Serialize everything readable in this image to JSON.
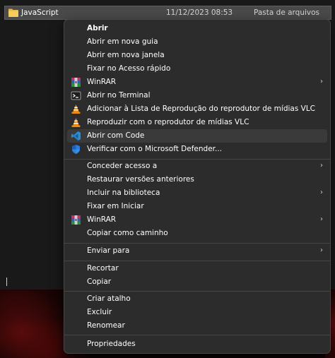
{
  "explorer": {
    "row": {
      "name": "JavaScript",
      "date": "11/12/2023 08:53",
      "type": "Pasta de arquivos"
    }
  },
  "menu": {
    "items": [
      {
        "label": "Abrir",
        "icon": "none"
      },
      {
        "label": "Abrir em nova guia",
        "icon": "none"
      },
      {
        "label": "Abrir em nova janela",
        "icon": "none"
      },
      {
        "label": "Fixar no Acesso rápido",
        "icon": "none"
      },
      {
        "label": "WinRAR",
        "icon": "winrar-icon",
        "submenu": true
      },
      {
        "label": "Abrir no Terminal",
        "icon": "terminal-icon"
      },
      {
        "label": "Adicionar à Lista de Reprodução do reprodutor de mídias VLC",
        "icon": "vlc-icon"
      },
      {
        "label": "Reproduzir com o reprodutor de mídias VLC",
        "icon": "vlc-icon"
      },
      {
        "label": "Abrir com Code",
        "icon": "vscode-icon",
        "highlighted": true
      },
      {
        "label": "Verificar com o Microsoft Defender...",
        "icon": "defender-icon"
      },
      {
        "label": "Conceder acesso a",
        "icon": "none",
        "submenu": true
      },
      {
        "label": "Restaurar versões anteriores",
        "icon": "none"
      },
      {
        "label": "Incluir na biblioteca",
        "icon": "none",
        "submenu": true
      },
      {
        "label": "Fixar em Iniciar",
        "icon": "none"
      },
      {
        "label": "WinRAR",
        "icon": "winrar-icon",
        "submenu": true
      },
      {
        "label": "Copiar como caminho",
        "icon": "none"
      },
      {
        "label": "Enviar para",
        "icon": "none",
        "submenu": true
      },
      {
        "label": "Recortar",
        "icon": "none"
      },
      {
        "label": "Copiar",
        "icon": "none"
      },
      {
        "label": "Criar atalho",
        "icon": "none"
      },
      {
        "label": "Excluir",
        "icon": "none"
      },
      {
        "label": "Renomear",
        "icon": "none"
      },
      {
        "label": "Propriedades",
        "icon": "none"
      }
    ],
    "submenu_glyph": "›"
  },
  "colors": {
    "menu_bg": "#2c2c2c",
    "hover_bg": "#3a3a3a",
    "separator": "#454545",
    "selected_row": "#4a4a4a"
  }
}
